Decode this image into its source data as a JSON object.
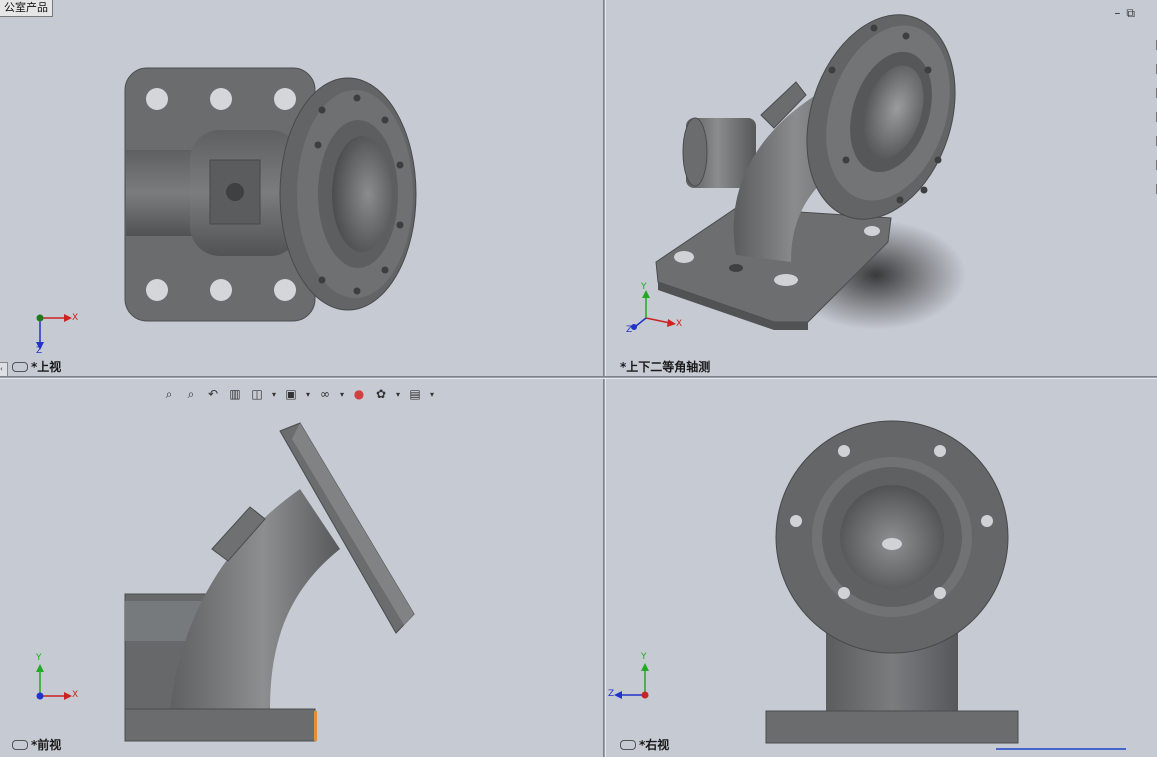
{
  "app": {
    "partial_tab": "公室产品"
  },
  "viewports": {
    "top": {
      "label": "*上视"
    },
    "iso": {
      "label": "*上下二等角轴测"
    },
    "front": {
      "label": "*前视"
    },
    "right": {
      "label": "*右视"
    }
  },
  "axes": {
    "x": "X",
    "y": "Y",
    "z": "Z"
  },
  "toolbar": {
    "items": [
      {
        "icon": "zoom-to-fit-icon",
        "glyph": "🔍"
      },
      {
        "icon": "zoom-to-area-icon",
        "glyph": "🔎"
      },
      {
        "icon": "previous-view-icon",
        "glyph": "↶"
      },
      {
        "icon": "section-view-icon",
        "glyph": "▥"
      },
      {
        "icon": "view-orientation-icon",
        "glyph": "◫"
      },
      {
        "icon": "display-style-icon",
        "glyph": "▣"
      },
      {
        "icon": "hide-show-items-icon",
        "glyph": "∞"
      },
      {
        "icon": "edit-appearance-icon",
        "glyph": "●"
      },
      {
        "icon": "apply-scene-icon",
        "glyph": "✿"
      },
      {
        "icon": "view-settings-icon",
        "glyph": "▤"
      }
    ]
  },
  "colors": {
    "viewport_bg": "#c6cad2",
    "model": "#6a6c6e",
    "axis_x": "#cc2222",
    "axis_y": "#22aa22",
    "axis_z": "#2233cc"
  }
}
